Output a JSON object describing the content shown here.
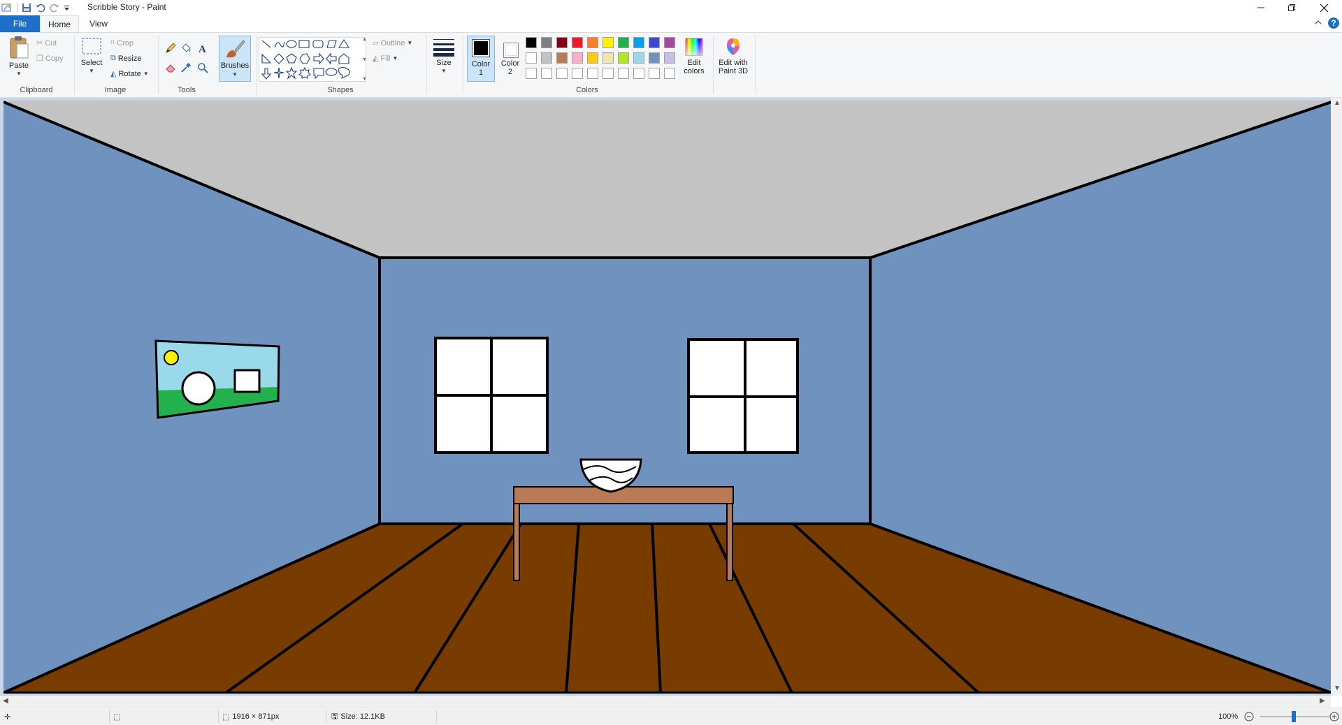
{
  "window": {
    "title": "Scribble Story - Paint",
    "controls": [
      "minimize",
      "restore",
      "close"
    ]
  },
  "quick_access": [
    "paint-app-icon",
    "save-icon",
    "undo-icon",
    "redo-icon",
    "customize-dropdown-icon"
  ],
  "tabs": [
    {
      "label": "File"
    },
    {
      "label": "Home"
    },
    {
      "label": "View"
    }
  ],
  "ribbon": {
    "clipboard": {
      "label": "Clipboard",
      "paste": "Paste",
      "cut": "Cut",
      "copy": "Copy"
    },
    "image": {
      "label": "Image",
      "select": "Select",
      "crop": "Crop",
      "resize": "Resize",
      "rotate": "Rotate"
    },
    "tools": {
      "label": "Tools",
      "items": [
        "pencil-icon",
        "fill-bucket-icon",
        "text-icon",
        "eraser-icon",
        "color-picker-icon",
        "magnifier-icon"
      ]
    },
    "brushes": {
      "label": "Brushes"
    },
    "shapes": {
      "label": "Shapes",
      "outline": "Outline",
      "fill": "Fill"
    },
    "size": {
      "label": "Size"
    },
    "colors": {
      "label": "Colors",
      "color1_line1": "Color",
      "color1_line2": "1",
      "color2_line1": "Color",
      "color2_line2": "2",
      "color1_value": "#000000",
      "color2_value": "#ffffff",
      "edit_colors_line1": "Edit",
      "edit_colors_line2": "colors",
      "paint3d_line1": "Edit with",
      "paint3d_line2": "Paint 3D",
      "palette_row1": [
        "#000000",
        "#7f7f7f",
        "#880015",
        "#ed1c24",
        "#ff7f27",
        "#fff200",
        "#22b14c",
        "#00a2e8",
        "#3f48cc",
        "#a349a4"
      ],
      "palette_row2": [
        "#ffffff",
        "#c3c3c3",
        "#b97a57",
        "#ffaec9",
        "#ffc90e",
        "#efe4b0",
        "#b5e61d",
        "#99d9ea",
        "#7092be",
        "#c8bfe7"
      ],
      "palette_row3": [
        "#ffffff",
        "#ffffff",
        "#ffffff",
        "#ffffff",
        "#ffffff",
        "#ffffff",
        "#ffffff",
        "#ffffff",
        "#ffffff",
        "#ffffff"
      ]
    }
  },
  "drawing": {
    "ceiling_color": "#c3c3c3",
    "wall_color": "#7092be",
    "floor_color": "#783c00",
    "table_color": "#b97a57",
    "picture_sky": "#99d9ea",
    "picture_grass": "#22b14c",
    "picture_sun": "#fff200"
  },
  "status": {
    "dimensions": "1916 × 871px",
    "size": "Size: 12.1KB",
    "zoom": "100%"
  }
}
